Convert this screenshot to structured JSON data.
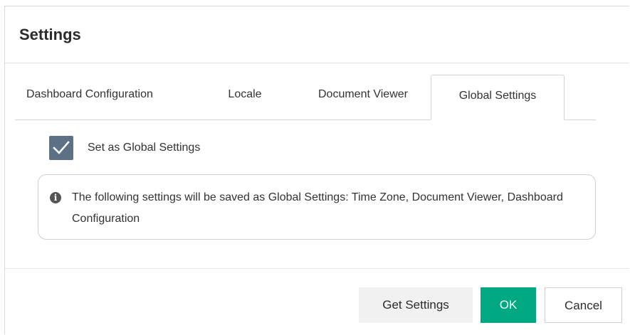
{
  "dialog": {
    "title": "Settings"
  },
  "tabs": [
    {
      "label": "Dashboard Configuration",
      "active": false
    },
    {
      "label": "Locale",
      "active": false
    },
    {
      "label": "Document Viewer",
      "active": false
    },
    {
      "label": "Global Settings",
      "active": true
    }
  ],
  "global_settings": {
    "checkbox_label": "Set as Global Settings",
    "checked": true,
    "info_icon": "info-circle-icon",
    "info_text": "The following settings will be saved as Global Settings: Time Zone, Document Viewer, Dashboard Configuration"
  },
  "footer": {
    "get_settings_label": "Get Settings",
    "ok_label": "OK",
    "cancel_label": "Cancel"
  },
  "colors": {
    "accent": "#01a982",
    "checkbox": "#5c7185",
    "secondary_button": "#f1f1f1"
  }
}
